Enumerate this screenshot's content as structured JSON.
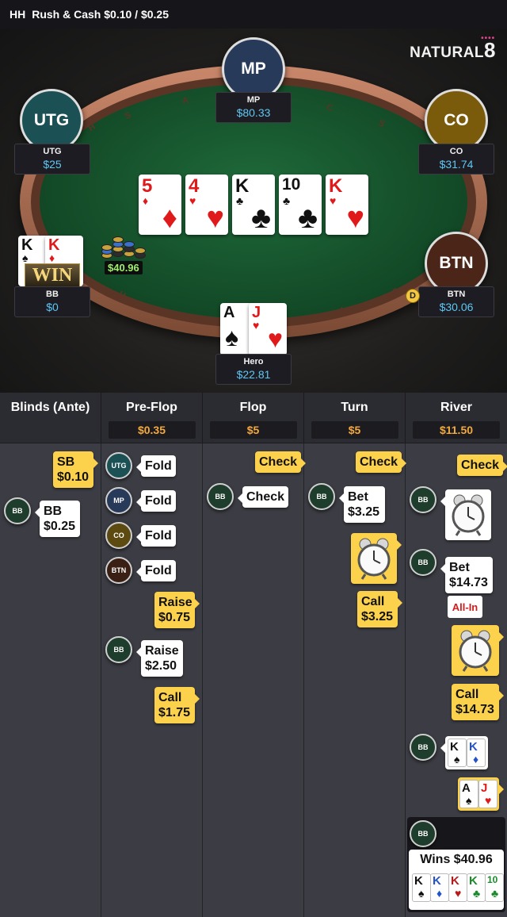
{
  "header": {
    "game_type": "HH",
    "title": "Rush & Cash $0.10 / $0.25"
  },
  "logo": {
    "text": "NATURAL",
    "number": "8"
  },
  "table": {
    "rail_letters": [
      "H",
      "S",
      "A",
      "C",
      "U",
      "S",
      "A",
      "S"
    ],
    "seats": {
      "mp": {
        "position": "MP",
        "name": "MP",
        "stack": "$80.33",
        "color": "#283a5a"
      },
      "utg": {
        "position": "UTG",
        "name": "UTG",
        "stack": "$25",
        "color": "#1b5054"
      },
      "co": {
        "position": "CO",
        "name": "CO",
        "stack": "$31.74",
        "color": "#7a5a0b"
      },
      "btn": {
        "position": "BTN",
        "name": "BTN",
        "stack": "$30.06",
        "color": "#4a2518"
      },
      "bb": {
        "name": "BB",
        "stack": "$0",
        "win_text": "WIN"
      },
      "hero": {
        "name": "Hero",
        "stack": "$22.81"
      }
    },
    "board": [
      {
        "rank": "5",
        "suit": "♦",
        "color": "red"
      },
      {
        "rank": "4",
        "suit": "♥",
        "color": "red"
      },
      {
        "rank": "K",
        "suit": "♣",
        "color": "black"
      },
      {
        "rank": "10",
        "suit": "♣",
        "color": "black"
      },
      {
        "rank": "K",
        "suit": "♥",
        "color": "red"
      }
    ],
    "bb_cards": [
      {
        "rank": "K",
        "suit": "♠"
      },
      {
        "rank": "K",
        "suit": "♦"
      }
    ],
    "hero_cards": [
      {
        "rank": "A",
        "suit": "♠"
      },
      {
        "rank": "J",
        "suit": "♥"
      }
    ],
    "pot": "$40.96",
    "dealer_button": "D"
  },
  "history": {
    "columns": [
      {
        "title": "Blinds (Ante)",
        "pot": ""
      },
      {
        "title": "Pre-Flop",
        "pot": "$0.35"
      },
      {
        "title": "Flop",
        "pot": "$5"
      },
      {
        "title": "Turn",
        "pot": "$5"
      },
      {
        "title": "River",
        "pot": "$11.50"
      }
    ],
    "blinds": {
      "sb_line1": "SB",
      "sb_line2": "$0.10",
      "bb_badge": "BB",
      "bb_line1": "BB",
      "bb_line2": "$0.25"
    },
    "preflop": {
      "utg_badge": "UTG",
      "utg_action": "Fold",
      "mp_badge": "MP",
      "mp_action": "Fold",
      "co_badge": "CO",
      "co_action": "Fold",
      "btn_badge": "BTN",
      "btn_action": "Fold",
      "hero_raise_line1": "Raise",
      "hero_raise_line2": "$0.75",
      "bb_badge": "BB",
      "bb_raise_line1": "Raise",
      "bb_raise_line2": "$2.50",
      "hero_call_line1": "Call",
      "hero_call_line2": "$1.75"
    },
    "flop": {
      "hero_action": "Check",
      "bb_badge": "BB",
      "bb_action": "Check"
    },
    "turn": {
      "hero_action": "Check",
      "bb_badge": "BB",
      "bb_bet_line1": "Bet",
      "bb_bet_line2": "$3.25",
      "hero_call_line1": "Call",
      "hero_call_line2": "$3.25"
    },
    "river": {
      "hero_action": "Check",
      "bb_badge": "BB",
      "bb_bet_line1": "Bet",
      "bb_bet_line2": "$14.73",
      "allin_label": "All-In",
      "hero_call_line1": "Call",
      "hero_call_line2": "$14.73",
      "bb_show_cards": [
        {
          "rank": "K",
          "suit": "♠"
        },
        {
          "rank": "K",
          "suit": "♦"
        }
      ],
      "hero_show_cards": [
        {
          "rank": "A",
          "suit": "♠"
        },
        {
          "rank": "J",
          "suit": "♥"
        }
      ],
      "wins_text": "Wins $40.96",
      "winning_hand": [
        {
          "rank": "K",
          "suit": "♠"
        },
        {
          "rank": "K",
          "suit": "♦"
        },
        {
          "rank": "K",
          "suit": "♥"
        },
        {
          "rank": "K",
          "suit": "♣"
        },
        {
          "rank": "10",
          "suit": "♣"
        }
      ]
    }
  }
}
